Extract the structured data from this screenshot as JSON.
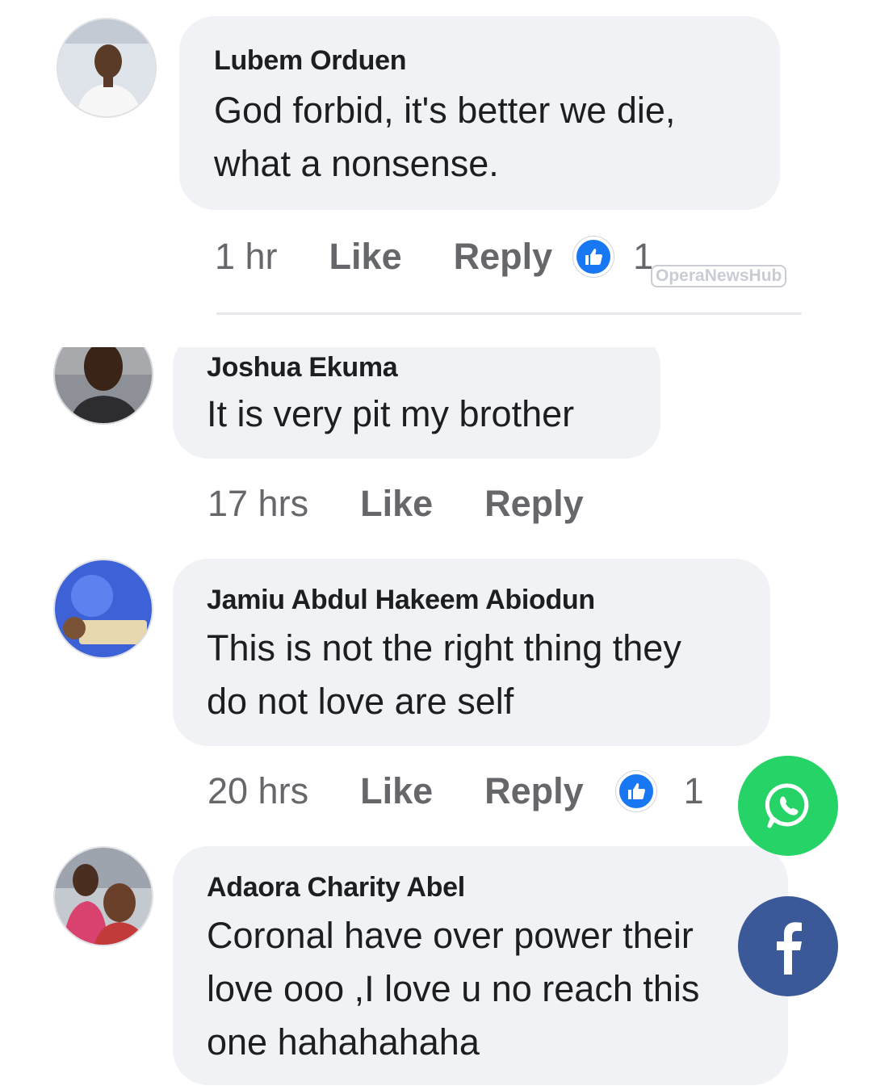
{
  "comments": [
    {
      "author": "Lubem Orduen",
      "lines": [
        "God forbid, it's better we die,",
        "what a nonsense."
      ],
      "time": "1 hr",
      "like_label": "Like",
      "reply_label": "Reply",
      "reaction_count": "1"
    },
    {
      "author": "Joshua Ekuma",
      "lines": [
        "It is very pit my brother"
      ],
      "time": "17 hrs",
      "like_label": "Like",
      "reply_label": "Reply"
    },
    {
      "author": "Jamiu Abdul Hakeem Abiodun",
      "lines": [
        "This is not the right thing they",
        "do not love are self"
      ],
      "time": "20 hrs",
      "like_label": "Like",
      "reply_label": "Reply",
      "reaction_count": "1"
    },
    {
      "author": "Adaora Charity Abel",
      "lines": [
        "Coronal have over power their",
        "love ooo ,I love u no reach this",
        "one hahahahaha"
      ]
    }
  ],
  "watermark": "OperaNewsHub",
  "share": {
    "whatsapp_icon": "whatsapp-icon",
    "facebook_icon": "facebook-icon"
  },
  "colors": {
    "bubble": "#f0f2f5",
    "like_blue": "#1877f2",
    "whatsapp": "#25d366",
    "facebook": "#3b5998",
    "meta_text": "#65676b"
  }
}
